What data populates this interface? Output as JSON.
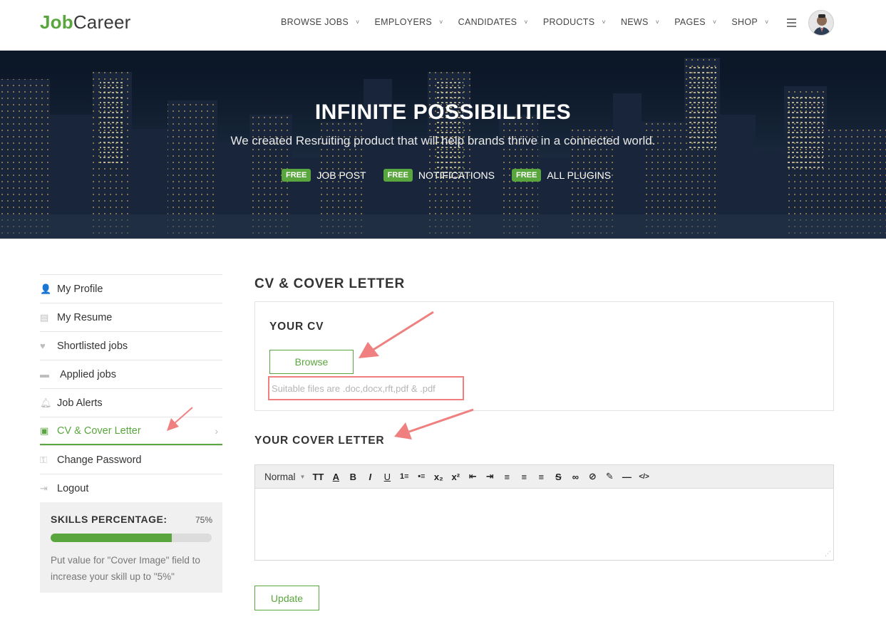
{
  "logo": {
    "part1": "Job",
    "part2": "Career"
  },
  "nav": [
    "BROWSE JOBS",
    "EMPLOYERS",
    "CANDIDATES",
    "PRODUCTS",
    "NEWS",
    "PAGES",
    "SHOP"
  ],
  "hero": {
    "title": "INFINITE  POSSIBILITIES",
    "subtitle": "We created Resruiting product that will help brands thrive in a connected world.",
    "badges": [
      {
        "tag": "FREE",
        "label": "JOB POST"
      },
      {
        "tag": "FREE",
        "label": "NOTIFICATIONS"
      },
      {
        "tag": "FREE",
        "label": "ALL PLUGINS"
      }
    ]
  },
  "sidebar": {
    "items": [
      {
        "label": "My Profile",
        "icon": "user-icon"
      },
      {
        "label": "My Resume",
        "icon": "document-icon"
      },
      {
        "label": "Shortlisted jobs",
        "icon": "heart-icon"
      },
      {
        "label": "Applied jobs",
        "icon": "briefcase-icon"
      },
      {
        "label": "Job Alerts",
        "icon": "bell-icon"
      },
      {
        "label": "CV & Cover Letter",
        "icon": "id-card-icon",
        "active": true
      },
      {
        "label": "Change Password",
        "icon": "key-icon"
      },
      {
        "label": "Logout",
        "icon": "logout-icon"
      }
    ],
    "skills": {
      "title": "SKILLS PERCENTAGE:",
      "value_label": "75%",
      "progress": 0.75,
      "hint": "Put value for \"Cover Image\" field to increase your skill up to \"5%\""
    }
  },
  "main": {
    "title": "CV & COVER LETTER",
    "cv_title": "YOUR CV",
    "browse_label": "Browse",
    "file_hint": "Suitable files are .doc,docx,rft,pdf & .pdf",
    "cover_title": "YOUR COVER LETTER",
    "editor": {
      "format": "Normal",
      "buttons": [
        "TT",
        "A",
        "B",
        "I",
        "U",
        "1≡",
        "•≡",
        "x₂",
        "x²",
        "⇤",
        "⇥",
        "≡",
        "≡",
        "≡",
        "S",
        "∞",
        "⊘",
        "✎",
        "—",
        "</>"
      ]
    },
    "update_label": "Update"
  },
  "colors": {
    "accent": "#5aa63e",
    "annotation": "#f08080"
  }
}
